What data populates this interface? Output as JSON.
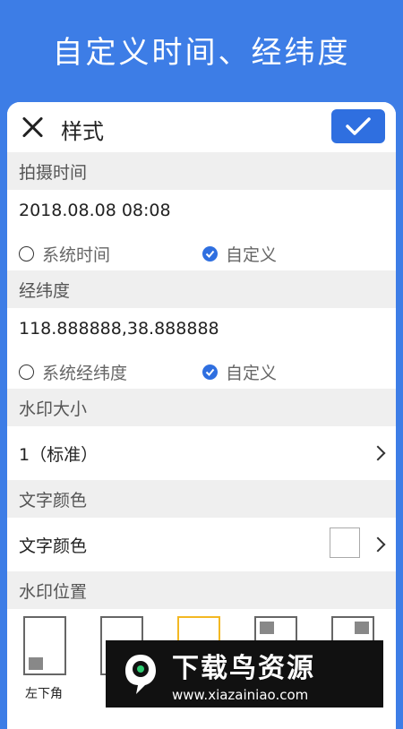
{
  "banner": {
    "title": "自定义时间、经纬度"
  },
  "header": {
    "title": "样式"
  },
  "sections": {
    "time": {
      "title": "拍摄时间",
      "value": "2018.08.08 08:08",
      "option_system": "系统时间",
      "option_custom": "自定义",
      "selected": "自定义"
    },
    "coords": {
      "title": "经纬度",
      "value": "118.888888,38.888888",
      "option_system": "系统经纬度",
      "option_custom": "自定义",
      "selected": "自定义"
    },
    "size": {
      "title": "水印大小",
      "value": "1（标准）"
    },
    "color": {
      "title": "文字颜色",
      "label": "文字颜色",
      "swatch_color": "#ffffff"
    },
    "position": {
      "title": "水印位置",
      "items": [
        "左下角"
      ]
    }
  },
  "colors": {
    "accent": "#2f6fe0",
    "banner": "#3d7de6",
    "selected_border": "#f3b823"
  },
  "watermark": {
    "brand": "下载鸟资源",
    "url": "www.xiazainiao.com"
  }
}
